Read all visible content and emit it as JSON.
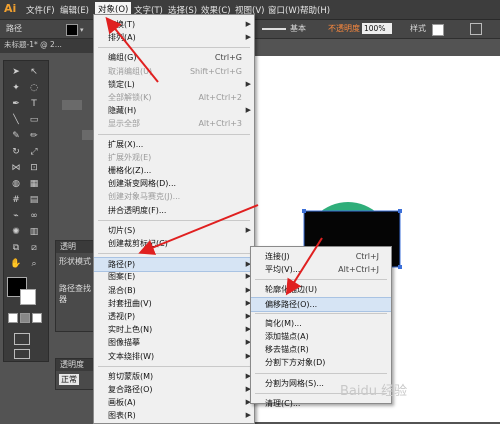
{
  "app": {
    "logo": "Ai"
  },
  "menubar": [
    {
      "label": "文件(F)"
    },
    {
      "label": "编辑(E)"
    },
    {
      "label": "对象(O)",
      "active": true
    },
    {
      "label": "文字(T)"
    },
    {
      "label": "选择(S)"
    },
    {
      "label": "效果(C)"
    },
    {
      "label": "视图(V)"
    },
    {
      "label": "窗口(W)"
    },
    {
      "label": "帮助(H)"
    }
  ],
  "controlbar": {
    "path_label": "路径",
    "stroke_style": "基本",
    "opacity_label": "不透明度",
    "opacity_value": "100%",
    "style_label": "样式"
  },
  "document_tab": "未标题-1* @ 2...",
  "panels": {
    "transparency_tab": "透明",
    "shape_mode": "形状模式",
    "pathfinder": "路径查找器",
    "transparency2": "透明度",
    "blend_mode": "正常"
  },
  "object_menu": [
    {
      "label": "变换(T)",
      "arrow": true
    },
    {
      "label": "排列(A)",
      "arrow": true
    },
    {
      "sep": true
    },
    {
      "label": "编组(G)",
      "shortcut": "Ctrl+G"
    },
    {
      "label": "取消编组(U)",
      "shortcut": "Shift+Ctrl+G",
      "disabled": true
    },
    {
      "label": "锁定(L)",
      "arrow": true
    },
    {
      "label": "全部解锁(K)",
      "shortcut": "Alt+Ctrl+2",
      "disabled": true
    },
    {
      "label": "隐藏(H)",
      "arrow": true
    },
    {
      "label": "显示全部",
      "shortcut": "Alt+Ctrl+3",
      "disabled": true
    },
    {
      "sep": true
    },
    {
      "label": "扩展(X)..."
    },
    {
      "label": "扩展外观(E)",
      "disabled": true
    },
    {
      "label": "栅格化(Z)..."
    },
    {
      "label": "创建渐变网格(D)..."
    },
    {
      "label": "创建对象马赛克(J)...",
      "disabled": true
    },
    {
      "label": "拼合透明度(F)..."
    },
    {
      "sep": true
    },
    {
      "label": "切片(S)",
      "arrow": true
    },
    {
      "label": "创建裁剪标记(C)"
    },
    {
      "sep": true
    },
    {
      "label": "路径(P)",
      "arrow": true,
      "highlight": true
    },
    {
      "label": "图案(E)",
      "arrow": true
    },
    {
      "label": "混合(B)",
      "arrow": true
    },
    {
      "label": "封套扭曲(V)",
      "arrow": true
    },
    {
      "label": "透视(P)",
      "arrow": true
    },
    {
      "label": "实时上色(N)",
      "arrow": true
    },
    {
      "label": "图像描摹",
      "arrow": true
    },
    {
      "label": "文本绕排(W)",
      "arrow": true
    },
    {
      "sep": true
    },
    {
      "label": "剪切蒙版(M)",
      "arrow": true
    },
    {
      "label": "复合路径(O)",
      "arrow": true
    },
    {
      "label": "画板(A)",
      "arrow": true
    },
    {
      "label": "图表(R)",
      "arrow": true
    }
  ],
  "path_submenu": [
    {
      "label": "连接(J)",
      "shortcut": "Ctrl+J"
    },
    {
      "label": "平均(V)...",
      "shortcut": "Alt+Ctrl+J"
    },
    {
      "sep": true
    },
    {
      "label": "轮廓化描边(U)"
    },
    {
      "label": "偏移路径(O)...",
      "highlight": true
    },
    {
      "sep": true
    },
    {
      "label": "简化(M)..."
    },
    {
      "label": "添加锚点(A)"
    },
    {
      "label": "移去锚点(R)"
    },
    {
      "label": "分割下方对象(D)"
    },
    {
      "sep": true
    },
    {
      "label": "分割为网格(S)..."
    },
    {
      "sep": true
    },
    {
      "label": "清理(C)..."
    }
  ],
  "watermark": "Baidu 经验",
  "colors": {
    "accent": "#e02020",
    "green_shape": "#2fae7a",
    "black_shape": "#050505"
  }
}
